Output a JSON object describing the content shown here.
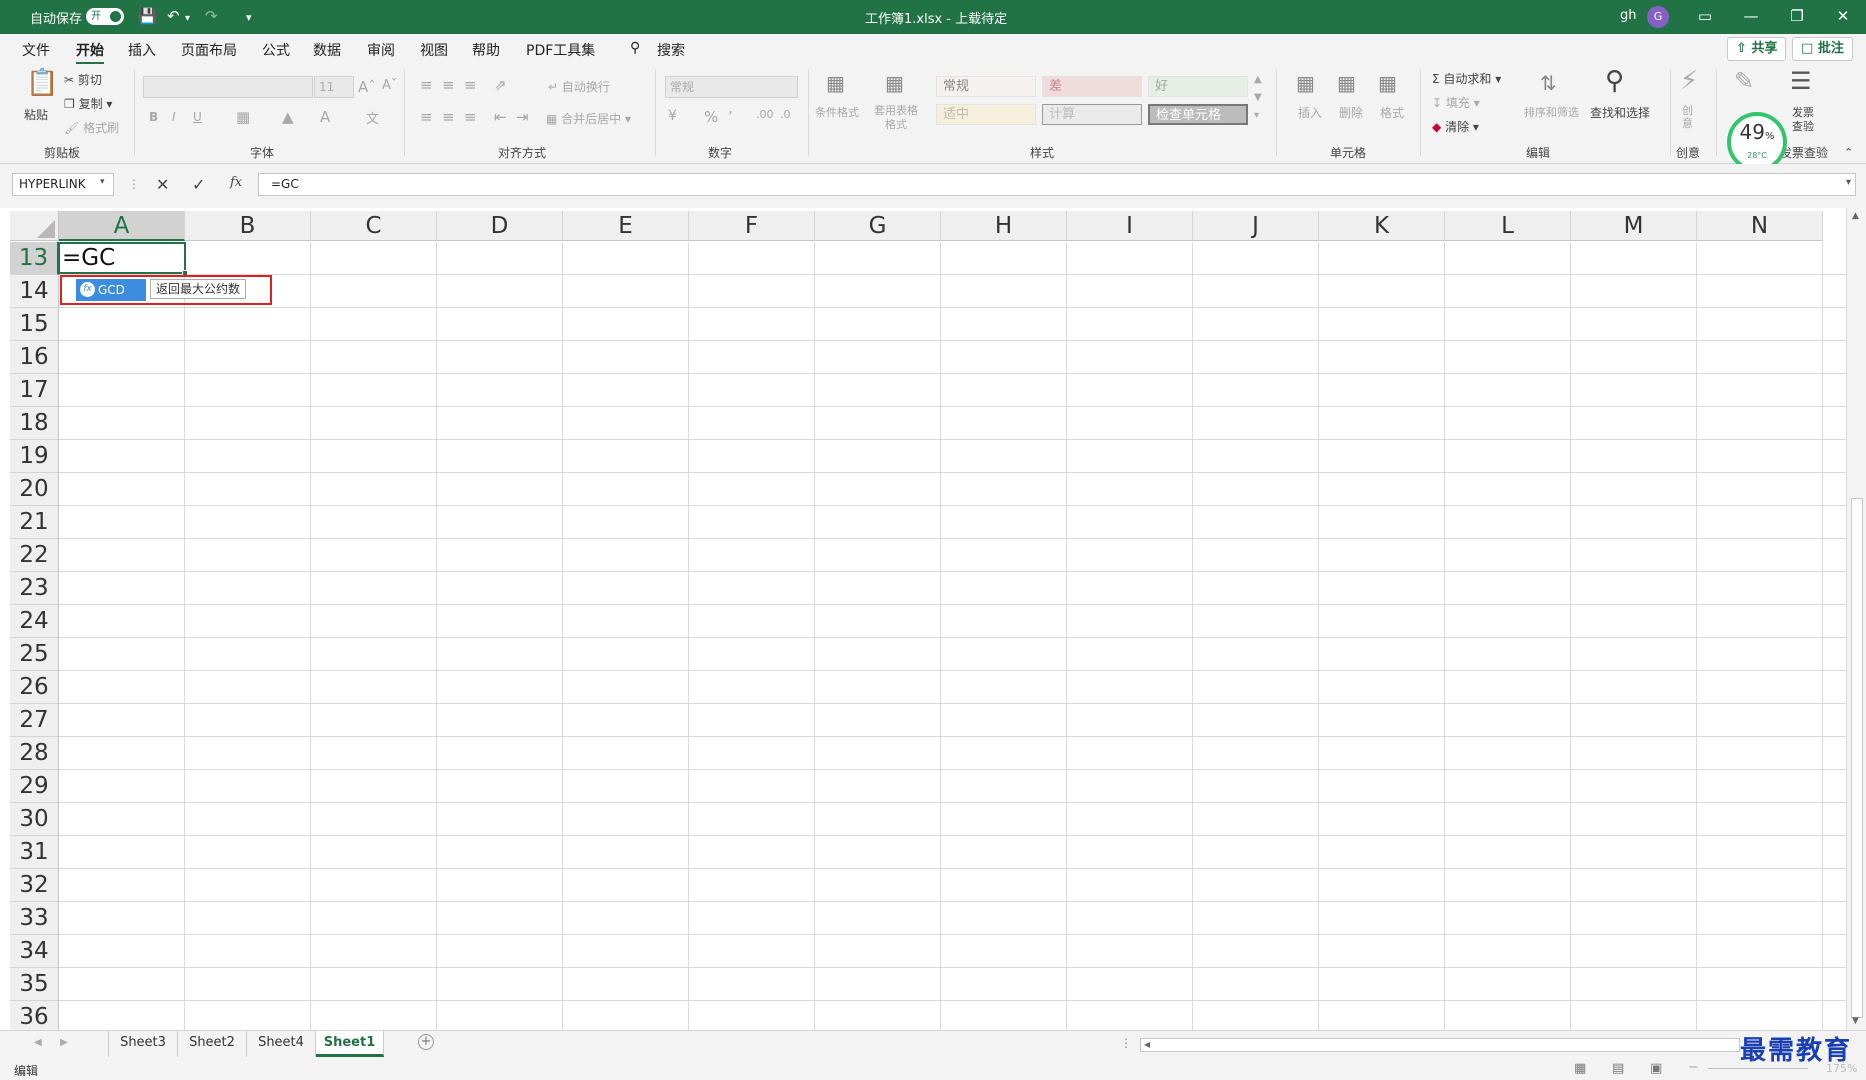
{
  "titlebar": {
    "autosave_label": "自动保存",
    "autosave_state": "开",
    "doc_title": "工作簿1.xlsx - 上载待定",
    "user_name": "gh",
    "avatar_letter": "G",
    "accent_color": "#217346"
  },
  "menu": {
    "items": [
      "文件",
      "开始",
      "插入",
      "页面布局",
      "公式",
      "数据",
      "审阅",
      "视图",
      "帮助",
      "PDF工具集"
    ],
    "active": "开始",
    "search_label": "搜索",
    "share_label": "共享",
    "comment_label": "批注"
  },
  "ribbon": {
    "clipboard": {
      "paste": "粘贴",
      "cut": "剪切",
      "copy": "复制",
      "format_painter": "格式刷",
      "group": "剪贴板"
    },
    "font": {
      "size": "11",
      "bold": "B",
      "italic": "I",
      "underline": "U",
      "group": "字体"
    },
    "alignment": {
      "wrap": "自动换行",
      "merge": "合并后居中",
      "group": "对齐方式"
    },
    "number": {
      "format": "常规",
      "group": "数字"
    },
    "styles": {
      "conditional": "条件格式",
      "table": "套用表格格式",
      "cells": [
        "常规",
        "差",
        "好",
        "适中",
        "计算",
        "检查单元格"
      ],
      "group": "样式"
    },
    "cells": {
      "insert": "插入",
      "delete": "删除",
      "format": "格式",
      "group": "单元格"
    },
    "editing": {
      "autosum": "自动求和",
      "fill": "填充",
      "clear": "清除",
      "sort": "排序和筛选",
      "find": "查找和选择",
      "group": "编辑"
    },
    "creative": {
      "label": "创意",
      "group": "创意"
    },
    "invoice": {
      "label1": "发票",
      "label2": "查验",
      "group": "发票查验"
    },
    "gauge": {
      "percent": "49",
      "unit": "%",
      "temp": "28°C"
    }
  },
  "formula_bar": {
    "name_box": "HYPERLINK",
    "fx": "fx",
    "formula": "=GC"
  },
  "grid": {
    "columns": [
      "A",
      "B",
      "C",
      "D",
      "E",
      "F",
      "G",
      "H",
      "I",
      "J",
      "K",
      "L",
      "M",
      "N"
    ],
    "rows": [
      "13",
      "14",
      "15",
      "16",
      "17",
      "18",
      "19",
      "20",
      "21",
      "22",
      "23",
      "24",
      "25",
      "26",
      "27",
      "28",
      "29",
      "30",
      "31",
      "32",
      "33",
      "34",
      "35",
      "36"
    ],
    "active_cell_value": "=GC",
    "autocomplete_item": "GCD",
    "autocomplete_tip": "返回最大公约数"
  },
  "sheets": {
    "tabs": [
      "Sheet3",
      "Sheet2",
      "Sheet4",
      "Sheet1"
    ],
    "active": "Sheet1"
  },
  "status": {
    "mode": "编辑",
    "zoom": "175%"
  },
  "watermark": "最需教育"
}
